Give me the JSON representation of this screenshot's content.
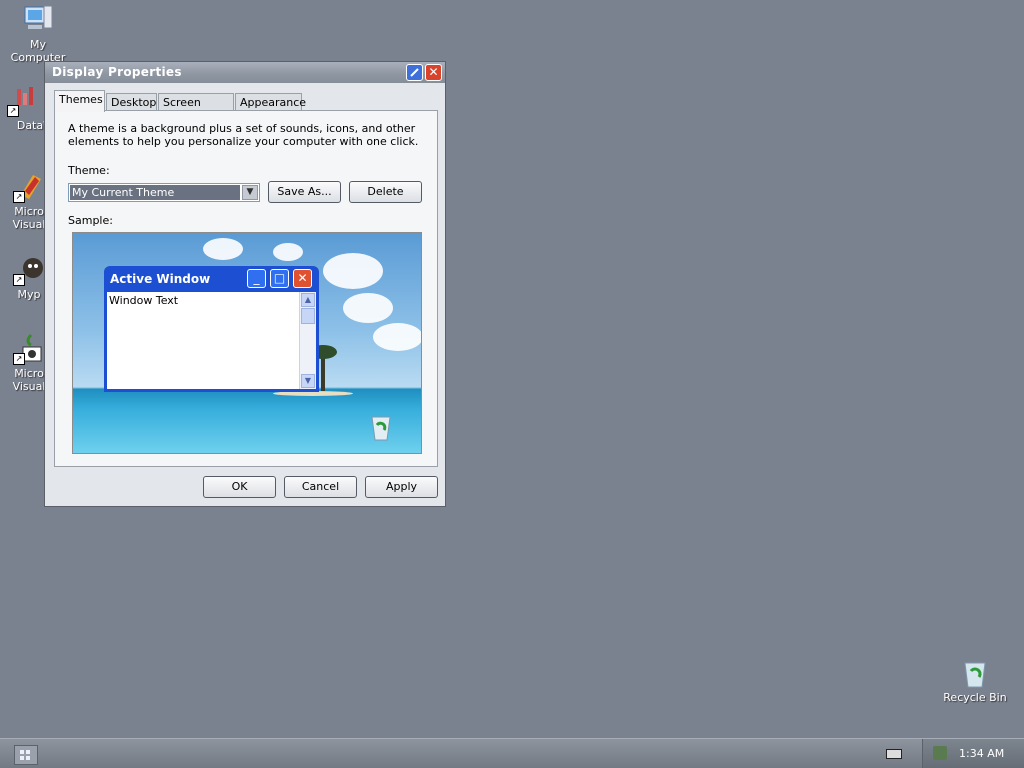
{
  "desktop": {
    "icons": [
      {
        "label": "My Computer",
        "label_line2": "Computer"
      },
      {
        "label": "DataW"
      },
      {
        "label": "Micro",
        "label_line2": "Visual"
      },
      {
        "label": "Myp"
      },
      {
        "label": "Micro",
        "label_line2": "Visual"
      }
    ],
    "recycle_bin_label": "Recycle Bin",
    "background_color": "#7a8290"
  },
  "window": {
    "title": "Display Properties",
    "tabs": [
      "Themes",
      "Desktop",
      "Screen Saver",
      "Appearance"
    ],
    "active_tab": "Themes",
    "description": "A theme is a background plus a set of sounds, icons, and other elements to help you personalize your computer with one click.",
    "theme_label": "Theme:",
    "theme_value": "My Current Theme",
    "save_as_label": "Save As...",
    "delete_label": "Delete",
    "sample_label": "Sample:",
    "sample_window_title": "Active Window",
    "sample_window_text": "Window Text",
    "ok_label": "OK",
    "cancel_label": "Cancel",
    "apply_label": "Apply"
  },
  "taskbar": {
    "clock": "1:34 AM"
  }
}
